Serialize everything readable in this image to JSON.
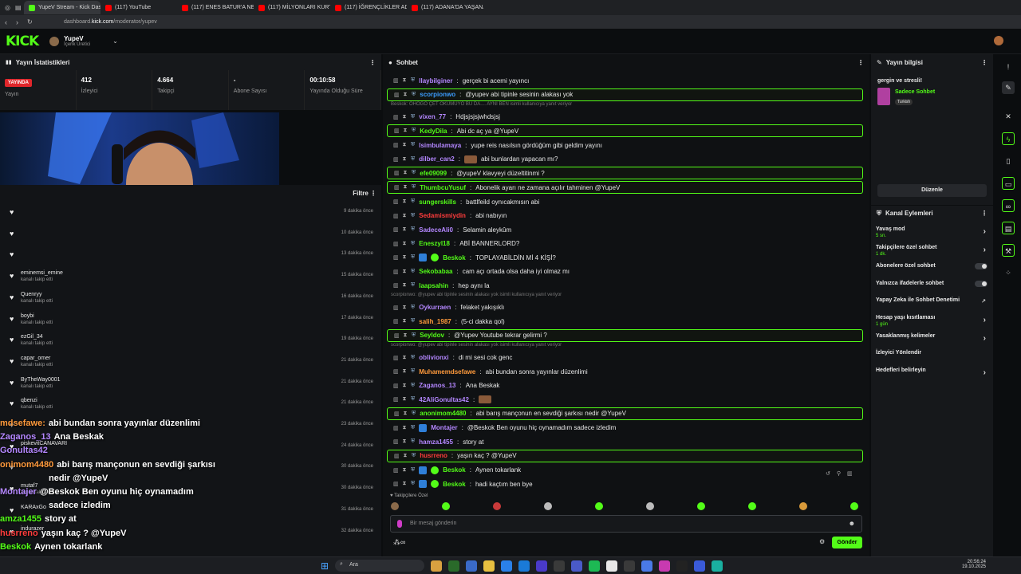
{
  "browser": {
    "tabs": [
      {
        "label": "YupeV Stream - Kick Dash",
        "color": "#53fc18"
      },
      {
        "label": "(117) YouTube",
        "color": "#ff0000"
      },
      {
        "label": "(117) ENES BATUR'A NE OLDU",
        "color": "#ff0000"
      },
      {
        "label": "(117) MİLYONLARI KURTARAN",
        "color": "#ff0000"
      },
      {
        "label": "(117) İĞRENÇLİKLER ADASI",
        "color": "#ff0000"
      },
      {
        "label": "(117) ADANA'DA YAŞANAN",
        "color": "#ff0000"
      }
    ],
    "url_prefix": "dashboard.",
    "url_host": "kick.com",
    "url_path": "/moderator/yupev"
  },
  "header": {
    "logo": "KICK",
    "username": "YupeV",
    "role": "İçerik Üretici"
  },
  "stats_panel": {
    "title": "Yayın İstatistikleri",
    "live_badge": "YAYINDA",
    "items": [
      {
        "value": "",
        "label": "Yayın"
      },
      {
        "value": "412",
        "label": "İzleyici"
      },
      {
        "value": "4.664",
        "label": "Takipçi"
      },
      {
        "value": "-",
        "label": "Abone Sayısı"
      },
      {
        "value": "00:10:58",
        "label": "Yayında Olduğu Süre"
      }
    ]
  },
  "activity": {
    "filter": "Filtre",
    "rows": [
      {
        "user": "",
        "action": "",
        "time": "9 dakika önce"
      },
      {
        "user": "",
        "action": "",
        "time": "10 dakika önce"
      },
      {
        "user": "",
        "action": "",
        "time": "13 dakika önce"
      },
      {
        "user": "eminemsi_emine",
        "action": "kanalı takip etti",
        "time": "15 dakika önce"
      },
      {
        "user": "Quenryy",
        "action": "kanalı takip etti",
        "time": "16 dakika önce"
      },
      {
        "user": "boybi",
        "action": "kanalı takip etti",
        "time": "17 dakika önce"
      },
      {
        "user": "ezGil_34",
        "action": "kanalı takip etti",
        "time": "19 dakika önce"
      },
      {
        "user": "capar_omer",
        "action": "kanalı takip etti",
        "time": "21 dakika önce"
      },
      {
        "user": "ByTheWay0001",
        "action": "kanalı takip etti",
        "time": "21 dakika önce"
      },
      {
        "user": "qbenzi",
        "action": "kanalı takip etti",
        "time": "21 dakika önce"
      },
      {
        "user": "",
        "action": "",
        "time": "23 dakika önce"
      },
      {
        "user": "piskevitCANAVARI",
        "action": "",
        "time": "24 dakika önce"
      },
      {
        "user": "",
        "action": "",
        "time": "30 dakika önce"
      },
      {
        "user": "mutaf7",
        "action": "kanalı takip etti",
        "time": "30 dakika önce"
      },
      {
        "user": "KARAxGo",
        "action": "",
        "time": "31 dakika önce"
      },
      {
        "user": "indurazer",
        "action": "",
        "time": "32 dakika önce"
      }
    ]
  },
  "overlay_chat": [
    {
      "user": "mdsefawe:",
      "text": "abi bundan sonra yayınlar düzenlimi",
      "color": "#ff9a3c"
    },
    {
      "user": "Zaganos_13",
      "text": "Ana Beskak",
      "color": "#b487ff"
    },
    {
      "user": "Gonultas42",
      "text": "",
      "color": "#b487ff"
    },
    {
      "user": "onimom4480",
      "text": "abi barış mançonun en sevdiği şarkısı",
      "color": "#ff9a3c"
    },
    {
      "user": "",
      "text": "nedir @YupeV",
      "color": "#ffffff"
    },
    {
      "user": "Montajer",
      "text": "@Beskok Ben oyunu hiç oynamadım",
      "color": "#b487ff"
    },
    {
      "user": "",
      "text": "sadece izledim",
      "color": "#ffffff"
    },
    {
      "user": "amza1455",
      "text": "story at",
      "color": "#53fc18"
    },
    {
      "user": "husrreno",
      "text": "yaşın kaç ? @YupeV",
      "color": "#ff3c3c"
    },
    {
      "user": "Beskok",
      "text": "Aynen tokarlank",
      "color": "#53fc18"
    },
    {
      "user": "Beskok",
      "text": "hadi kaçtım ben bye",
      "color": "#53fc18"
    }
  ],
  "chat": {
    "title": "Sohbet",
    "messages": [
      {
        "user": "llaybilginer",
        "text": "gerçek bi acemi yayıncı",
        "color": "#b487ff",
        "hl": false
      },
      {
        "user": "scorpionwo",
        "text": "@yupev abi tipinle sesinin alakası yok",
        "color": "#3c9cff",
        "hl": true
      },
      {
        "user": "vixen_77",
        "text": "Hdjsjsjsjwhdsjsj",
        "color": "#b487ff",
        "hl": false,
        "reply": "Beskok: OHOGO ÇET OKUMUYO BU DA.... AYNI BEN isimli kullanıcıya yanıt veriyor"
      },
      {
        "user": "KedyDila",
        "text": "Abi dc aç ya @YupeV",
        "color": "#53fc18",
        "hl": true
      },
      {
        "user": "lsimbulamaya",
        "text": "yupe reis nasılsın gördüğüm gibi geldim yayını",
        "color": "#b487ff",
        "hl": false
      },
      {
        "user": "dilber_can2",
        "text": "abi bunlardan yapacan mı?",
        "color": "#b487ff",
        "hl": false,
        "emote": true
      },
      {
        "user": "efe09099",
        "text": "@yupeV klavyeyi düzeltitinmi ?",
        "color": "#53fc18",
        "hl": true
      },
      {
        "user": "ThumbcuYusuf",
        "text": "Abonelik ayarı ne zamana açılır tahminen @YupeV",
        "color": "#53fc18",
        "hl": true
      },
      {
        "user": "sungerskills",
        "text": "battlfeild oynıcakmısın abi",
        "color": "#53fc18",
        "hl": false
      },
      {
        "user": "Sedamismiydin",
        "text": "abi nabıyın",
        "color": "#ff3c3c",
        "hl": false
      },
      {
        "user": "SadeceAli0",
        "text": "Selamin aleykûm",
        "color": "#b487ff",
        "hl": false
      },
      {
        "user": "Eneszyl18",
        "text": "ABİ BANNERLORD?",
        "color": "#53fc18",
        "hl": false
      },
      {
        "user": "Beskok",
        "text": "TOPLAYABİLDİN Mİ 4 KİŞİ?",
        "color": "#53fc18",
        "hl": false,
        "badges": true
      },
      {
        "user": "Sekobabaa",
        "text": "cam açı ortada olsa daha iyi olmaz mı",
        "color": "#53fc18",
        "hl": false
      },
      {
        "user": "laapsahin",
        "text": "hep aynı la",
        "color": "#53fc18",
        "hl": false
      },
      {
        "user": "Oykurraen",
        "text": "felaket yakışıklı",
        "color": "#b487ff",
        "hl": false,
        "reply": "scorpionwo: @yupev abi tipinle sesinin alakası yok isimli kullanıcıya yanıt veriyor"
      },
      {
        "user": "salih_1987",
        "text": "(5-ci dakka qol)",
        "color": "#ff9a3c",
        "hl": false
      },
      {
        "user": "Seyldov",
        "text": "@Yupev Youtube tekrar gelirmi ?",
        "color": "#53fc18",
        "hl": true
      },
      {
        "user": "oblivionxi",
        "text": "di mi sesi cok genc",
        "color": "#b487ff",
        "hl": false,
        "reply": "scorpionwo: @yupev abi tipinle sesinin alakası yok isimli kullanıcıya yanıt veriyor"
      },
      {
        "user": "Muhamemdsefawe",
        "text": "abi bundan sonra yayınlar düzenlimi",
        "color": "#ff9a3c",
        "hl": false
      },
      {
        "user": "Zaganos_13",
        "text": "Ana Beskak",
        "color": "#b487ff",
        "hl": false
      },
      {
        "user": "42AliGonultas42",
        "text": "",
        "color": "#b487ff",
        "hl": false,
        "emote": true
      },
      {
        "user": "anonimom4480",
        "text": "abi barış mançonun en sevdiği şarkısı nedir @YupeV",
        "color": "#53fc18",
        "hl": true
      },
      {
        "user": "Montajer",
        "text": "@Beskok Ben oyunu hiç oynamadım sadece izledim",
        "color": "#b487ff",
        "hl": false,
        "blue": true
      },
      {
        "user": "hamza1455",
        "text": "story at",
        "color": "#b487ff",
        "hl": false
      },
      {
        "user": "husrreno",
        "text": "yaşın kaç ? @YupeV",
        "color": "#ff3c3c",
        "hl": true
      },
      {
        "user": "Beskok",
        "text": "Aynen tokarlank",
        "color": "#53fc18",
        "hl": false,
        "badges": true
      },
      {
        "user": "Beskok",
        "text": "hadi kaçtım ben bye",
        "color": "#53fc18",
        "hl": false,
        "badges": true
      }
    ],
    "followers_only_label": "Takipçilere Özel",
    "input_placeholder": "Bir mesaj gönderin",
    "send_label": "Gönder"
  },
  "stream_info": {
    "title": "Yayın bilgisi",
    "stream_title": "gergin ve stresli!",
    "category": "Sadece Sohbet",
    "language": "Turkish",
    "edit_label": "Düzenle"
  },
  "channel_actions": {
    "title": "Kanal Eylemleri",
    "items": [
      {
        "label": "Yavaş mod",
        "sub": "5 sn.",
        "kind": "chev"
      },
      {
        "label": "Takipçilere özel sohbet",
        "sub": "1 dk.",
        "kind": "chev"
      },
      {
        "label": "Abonelere özel sohbet",
        "sub": "",
        "kind": "toggle"
      },
      {
        "label": "Yalnızca ifadelerle sohbet",
        "sub": "",
        "kind": "toggle"
      },
      {
        "label": "Yapay Zeka ile Sohbet Denetimi",
        "sub": "",
        "kind": "ext"
      },
      {
        "label": "Hesap yaşı kısıtlaması",
        "sub": "1 gün",
        "kind": "chev"
      },
      {
        "label": "Yasaklanmış kelimeler",
        "sub": "",
        "kind": "chev"
      },
      {
        "label": "İzleyici Yönlendir",
        "sub": "",
        "kind": "none"
      },
      {
        "label": "Hedefleri belirleyin",
        "sub": "",
        "kind": "chev"
      }
    ]
  },
  "taskbar": {
    "search": "Ara",
    "time": "20:56:24",
    "date": "19.10.2025"
  },
  "colors": {
    "accent": "#53fc18",
    "live": "#e0262b"
  }
}
